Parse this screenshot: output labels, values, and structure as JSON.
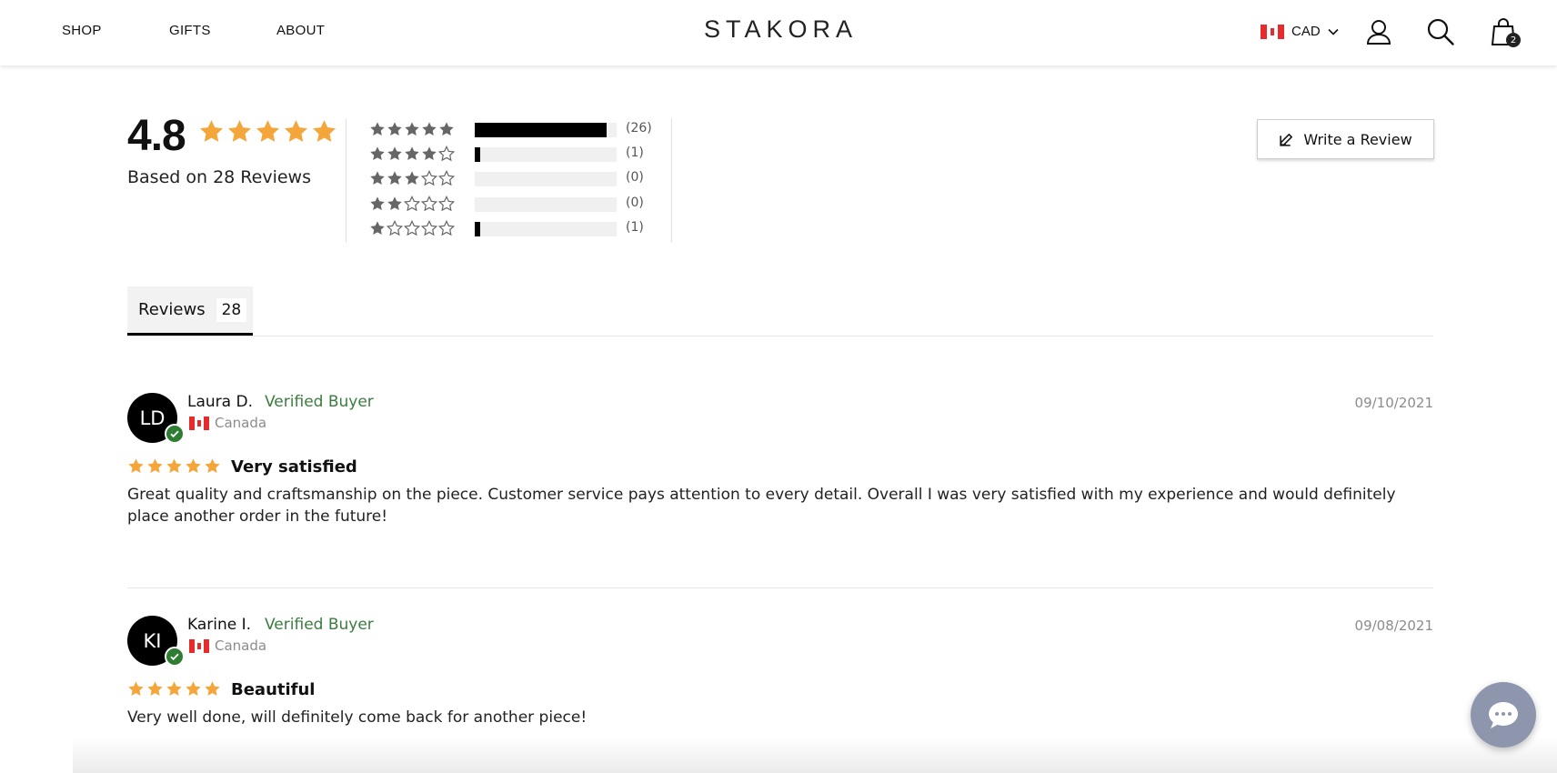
{
  "header": {
    "nav": [
      "SHOP",
      "GIFTS",
      "ABOUT"
    ],
    "logo": "STAKORA",
    "currency": "CAD",
    "cart_count": "2"
  },
  "summary": {
    "average": "4.8",
    "average_stars": 5,
    "based_on": "Based on 28 Reviews",
    "distribution": [
      {
        "stars": 5,
        "count_label": "(26)",
        "fraction": 0.929
      },
      {
        "stars": 4,
        "count_label": "(1)",
        "fraction": 0.036
      },
      {
        "stars": 3,
        "count_label": "(0)",
        "fraction": 0
      },
      {
        "stars": 2,
        "count_label": "(0)",
        "fraction": 0
      },
      {
        "stars": 1,
        "count_label": "(1)",
        "fraction": 0.036
      }
    ],
    "write_review_label": "Write a Review"
  },
  "tabs": [
    {
      "label": "Reviews",
      "count": "28"
    }
  ],
  "reviews": [
    {
      "initials": "LD",
      "name": "Laura D.",
      "verified": "Verified Buyer",
      "country": "Canada",
      "date": "09/10/2021",
      "rating": 5,
      "title": "Very satisfied",
      "body": "Great quality and craftsmanship on the piece. Customer service pays attention to every detail. Overall I was very satisfied with my experience and would definitely place another order in the future!"
    },
    {
      "initials": "KI",
      "name": "Karine I.",
      "verified": "Verified Buyer",
      "country": "Canada",
      "date": "09/08/2021",
      "rating": 5,
      "title": "Beautiful",
      "body": "Very well done, will definitely come back for another piece!"
    }
  ],
  "colors": {
    "star": "#f4a63b",
    "verified": "#3a7d3e",
    "verified_badge": "#2e7d32",
    "bar_fill": "#000000",
    "bar_track": "#f0f0f0",
    "chat_button": "#8d96ad"
  },
  "icons": {
    "currency_flag": "canada-flag-icon",
    "account": "user-icon",
    "search": "search-icon",
    "cart": "shopping-bag-icon",
    "write": "edit-icon",
    "chat": "chat-bubble-icon"
  }
}
